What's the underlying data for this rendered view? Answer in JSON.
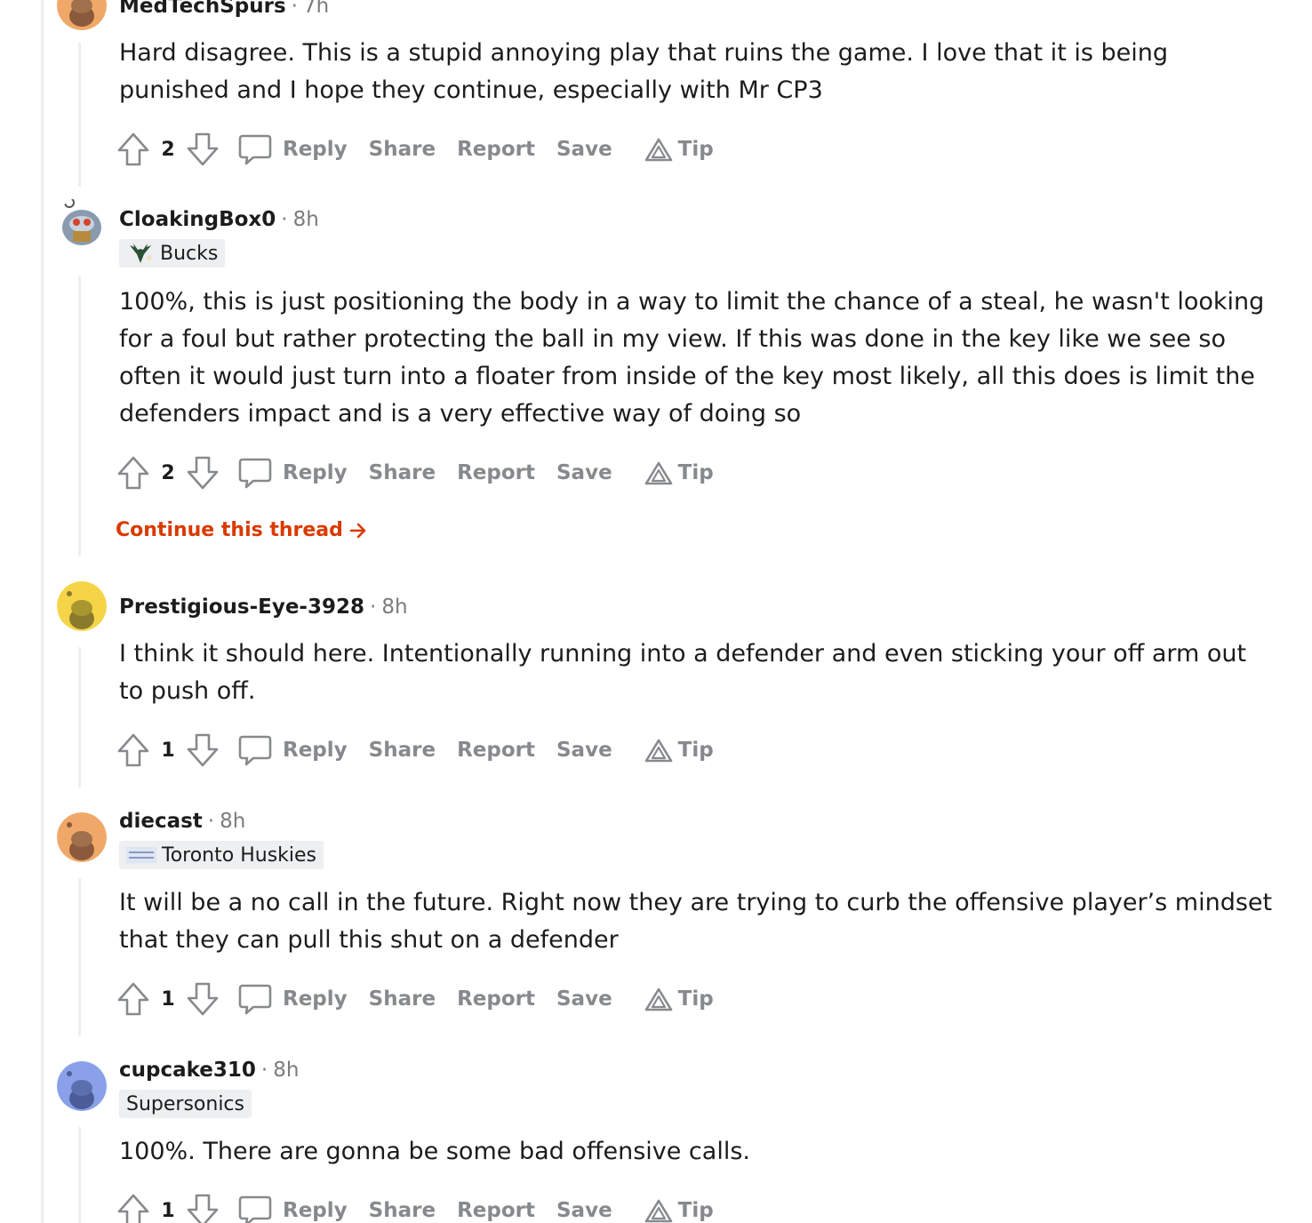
{
  "comments": [
    {
      "username": "MedTechSpurs",
      "time": "7h",
      "flair": null,
      "body": "Hard disagree. This is a stupid annoying play that ruins the game. I love that it is being punished and I hope they continue, especially with Mr CP3",
      "score": "2",
      "avatar_color": "#f0a868"
    },
    {
      "username": "CloakingBox0",
      "time": "8h",
      "flair": "Bucks",
      "body": "100%, this is just positioning the body in a way to limit the chance of a steal, he wasn't looking for a foul but rather protecting the ball in my view. If this was done in the key like we see so often it would just turn into a floater from inside of the key most likely, all this does is limit the defenders impact and is a very effective way of doing so",
      "score": "2",
      "avatar_color": "#8a9bb0"
    },
    {
      "username": "Prestigious-Eye-3928",
      "time": "8h",
      "flair": null,
      "body": "I think it should here. Intentionally running into a defender and even sticking your off arm out to push off.",
      "score": "1",
      "avatar_color": "#f5d547"
    },
    {
      "username": "diecast",
      "time": "8h",
      "flair": "Toronto Huskies",
      "body": "It will be a no call in the future. Right now they are trying to curb the offensive player’s mindset that they can pull this shut on a defender",
      "score": "1",
      "avatar_color": "#f0a868"
    },
    {
      "username": "cupcake310",
      "time": "8h",
      "flair": "Supersonics",
      "body": "100%. There are gonna be some bad offensive calls.",
      "score": "1",
      "avatar_color": "#8aa0e8"
    }
  ],
  "actions": {
    "reply": "Reply",
    "share": "Share",
    "report": "Report",
    "save": "Save",
    "tip": "Tip"
  },
  "continue_thread": "Continue this thread",
  "colors": {
    "accent": "#d93a00",
    "muted": "#878a8c",
    "thread_line": "#edeff1"
  },
  "icons": {
    "upvote": "upvote-arrow-icon",
    "downvote": "downvote-arrow-icon",
    "comment": "comment-bubble-icon",
    "tip": "tip-triangle-icon",
    "continue": "arrow-right-icon"
  }
}
